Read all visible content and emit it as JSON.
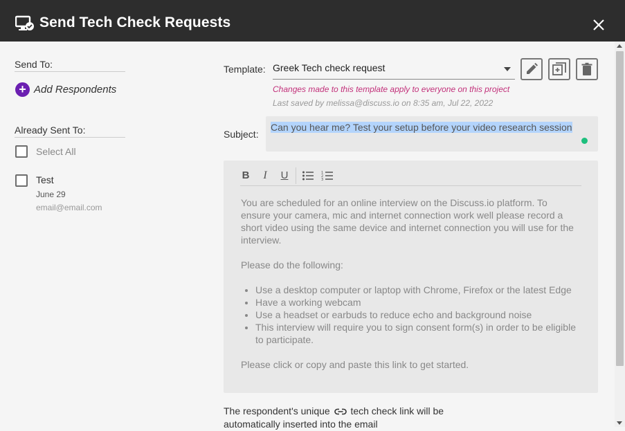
{
  "dialog": {
    "title": "Send Tech Check Requests",
    "title_icon": "monitor-check-icon",
    "close_icon": "close-icon"
  },
  "left": {
    "send_to_label": "Send To:",
    "add_respondents_label": "Add Respondents",
    "already_sent_label": "Already Sent To:",
    "select_all_label": "Select All",
    "respondents": [
      {
        "name": "Test",
        "date": "June 29",
        "email": "email@email.com"
      }
    ]
  },
  "template": {
    "label": "Template:",
    "selected": "Greek Tech check request",
    "warning": "Changes made to this template apply to everyone on this project",
    "last_saved": "Last saved by melissa@discuss.io on 8:35 am, Jul 22, 2022"
  },
  "subject": {
    "label": "Subject:",
    "value": "Can you hear me? Test your setup before your video research session"
  },
  "editor": {
    "paragraph1": "You are scheduled for an online interview on the Discuss.io platform. To ensure your camera, mic and internet connection work well please record a short video using the same device and internet connection you will use for the interview.",
    "paragraph2": "Please do the following:",
    "bullets": [
      "Use a desktop computer or laptop with Chrome, Firefox or the latest Edge",
      "Have a working webcam",
      "Use a headset or earbuds to reduce echo and background noise",
      "This interview will require you to sign consent form(s) in order to be eligible to participate."
    ],
    "paragraph3": "Please click or copy and paste this link to get started."
  },
  "footer": {
    "text_before": "The respondent's unique",
    "text_after": "tech check link will be automatically inserted into the email"
  },
  "colors": {
    "header_bg": "#2d2d2d",
    "accent_purple": "#6b1fb1",
    "warning_pink": "#c2307a",
    "status_green": "#1dbf7d",
    "selection_blue": "#b3d4fc"
  }
}
